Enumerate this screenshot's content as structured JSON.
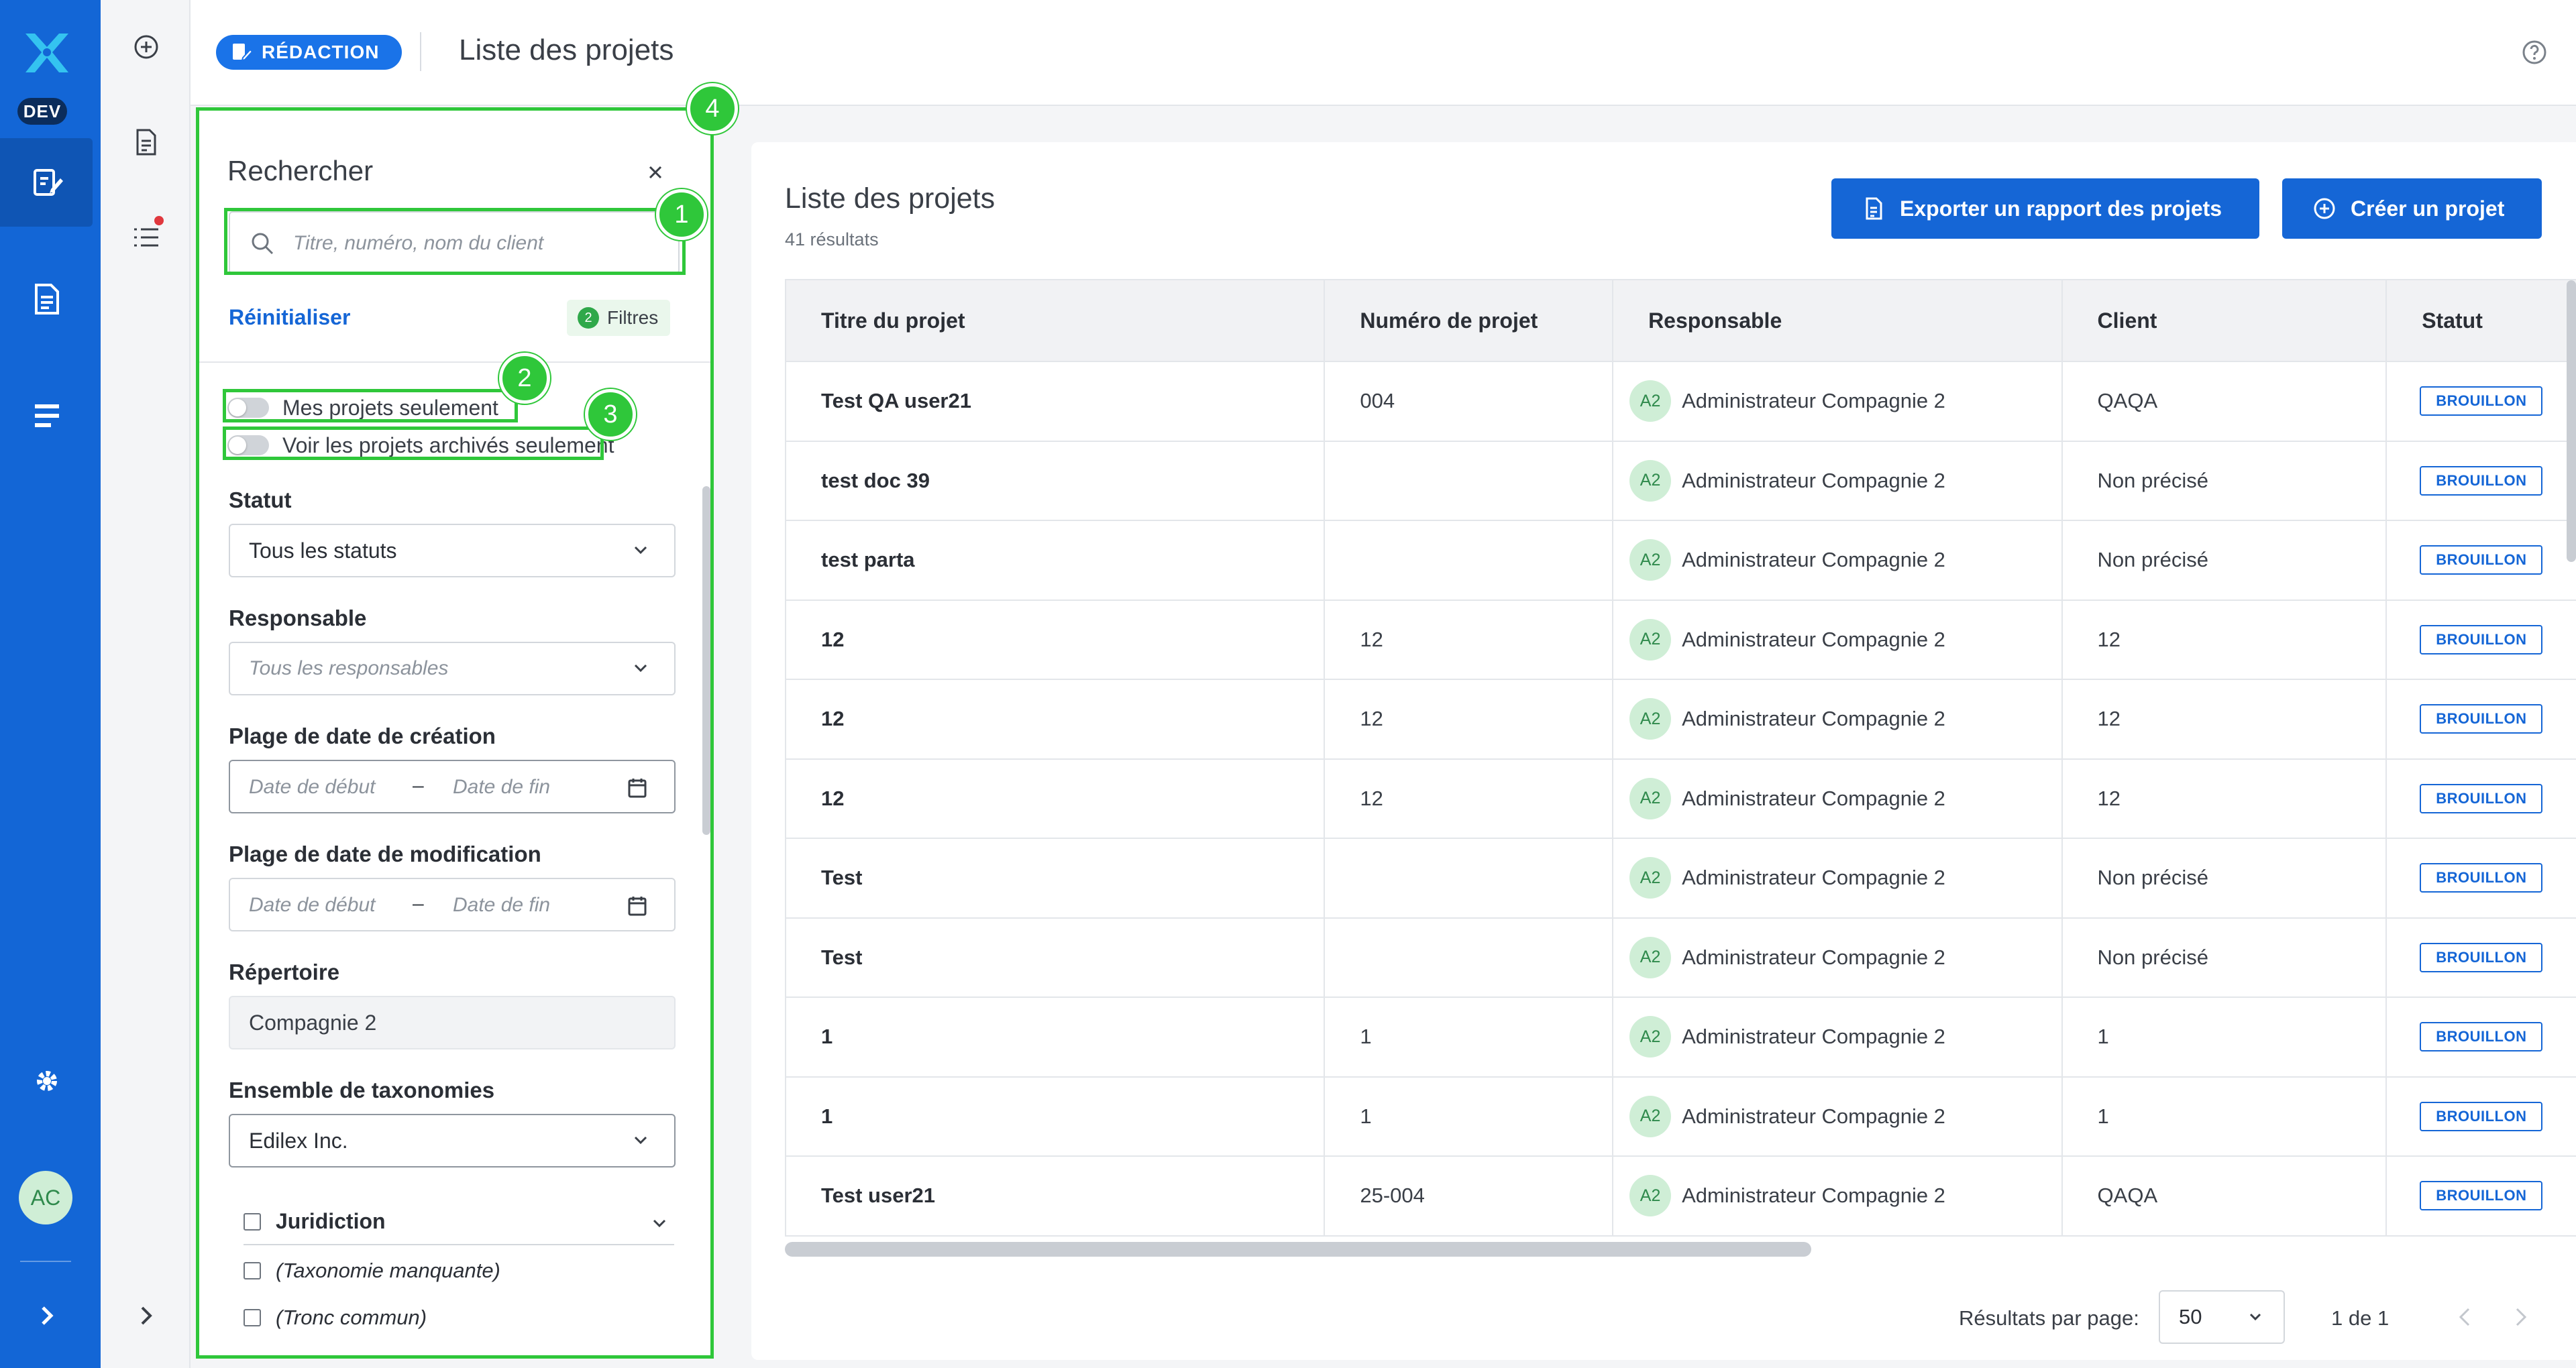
{
  "rail": {
    "env_badge": "DEV",
    "user_initials": "AC"
  },
  "header": {
    "mode_badge": "RÉDACTION",
    "title": "Liste des projets"
  },
  "filters": {
    "title": "Rechercher",
    "search_placeholder": "Titre, numéro, nom du client",
    "reset_label": "Réinitialiser",
    "filters_count": "2",
    "filters_label": "Filtres",
    "toggle_my_projects": "Mes projets seulement",
    "toggle_archived": "Voir les projets archivés seulement",
    "status_label": "Statut",
    "status_value": "Tous les statuts",
    "owner_label": "Responsable",
    "owner_placeholder": "Tous les responsables",
    "created_label": "Plage de date de création",
    "modified_label": "Plage de date de modification",
    "date_start_placeholder": "Date de début",
    "date_end_placeholder": "Date de fin",
    "date_separator": "–",
    "directory_label": "Répertoire",
    "directory_value": "Compagnie 2",
    "taxonomy_label": "Ensemble de taxonomies",
    "taxonomy_value": "Edilex Inc.",
    "tax_items": [
      "Juridiction",
      "(Taxonomie manquante)",
      "(Tronc commun)"
    ]
  },
  "callouts": [
    "1",
    "2",
    "3",
    "4"
  ],
  "list": {
    "title": "Liste des projets",
    "count": "41 résultats",
    "export_button": "Exporter un rapport des projets",
    "create_button": "Créer un projet",
    "columns": [
      "Titre du projet",
      "Numéro de projet",
      "Responsable",
      "Client",
      "Statut"
    ],
    "rows": [
      {
        "title": "Test QA user21",
        "number": "004",
        "owner_initials": "A2",
        "owner": "Administrateur Compagnie 2",
        "client": "QAQA",
        "status": "BROUILLON"
      },
      {
        "title": "test doc 39",
        "number": "",
        "owner_initials": "A2",
        "owner": "Administrateur Compagnie 2",
        "client": "Non précisé",
        "status": "BROUILLON"
      },
      {
        "title": "test parta",
        "number": "",
        "owner_initials": "A2",
        "owner": "Administrateur Compagnie 2",
        "client": "Non précisé",
        "status": "BROUILLON"
      },
      {
        "title": "12",
        "number": "12",
        "owner_initials": "A2",
        "owner": "Administrateur Compagnie 2",
        "client": "12",
        "status": "BROUILLON"
      },
      {
        "title": "12",
        "number": "12",
        "owner_initials": "A2",
        "owner": "Administrateur Compagnie 2",
        "client": "12",
        "status": "BROUILLON"
      },
      {
        "title": "12",
        "number": "12",
        "owner_initials": "A2",
        "owner": "Administrateur Compagnie 2",
        "client": "12",
        "status": "BROUILLON"
      },
      {
        "title": "Test",
        "number": "",
        "owner_initials": "A2",
        "owner": "Administrateur Compagnie 2",
        "client": "Non précisé",
        "status": "BROUILLON"
      },
      {
        "title": "Test",
        "number": "",
        "owner_initials": "A2",
        "owner": "Administrateur Compagnie 2",
        "client": "Non précisé",
        "status": "BROUILLON"
      },
      {
        "title": "1",
        "number": "1",
        "owner_initials": "A2",
        "owner": "Administrateur Compagnie 2",
        "client": "1",
        "status": "BROUILLON"
      },
      {
        "title": "1",
        "number": "1",
        "owner_initials": "A2",
        "owner": "Administrateur Compagnie 2",
        "client": "1",
        "status": "BROUILLON"
      },
      {
        "title": "Test user21",
        "number": "25-004",
        "owner_initials": "A2",
        "owner": "Administrateur Compagnie 2",
        "client": "QAQA",
        "status": "BROUILLON"
      }
    ],
    "per_page_label": "Résultats par page:",
    "per_page_value": "50",
    "page_info": "1 de 1"
  },
  "colors": {
    "primary": "#1566d6",
    "rail": "#1366d6",
    "callout": "#2fc73a"
  },
  "icons": [
    "app-logo-icon",
    "edit-document-icon",
    "document-icon",
    "list-icon",
    "gear-icon",
    "chevron-right-icon",
    "add-circle-icon",
    "file-icon",
    "checklist-icon",
    "help-icon",
    "close-icon",
    "search-icon",
    "chevron-down-icon",
    "calendar-icon",
    "export-file-icon",
    "add-icon",
    "chevron-left-icon"
  ]
}
